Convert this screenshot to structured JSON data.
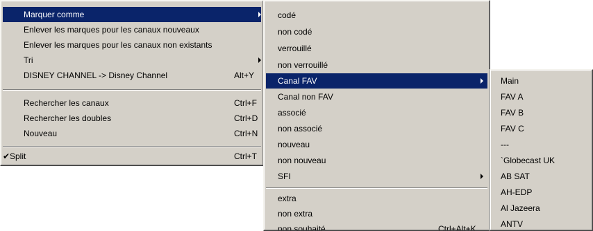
{
  "menu1": {
    "items": [
      {
        "label": "Marquer comme",
        "shortcut": "",
        "submenu": true,
        "selected": true
      },
      {
        "label": "Enlever les marques pour les canaux nouveaux",
        "shortcut": ""
      },
      {
        "label": "Enlever les marques pour les canaux non existants",
        "shortcut": ""
      },
      {
        "label": "Tri",
        "shortcut": "",
        "submenu": true
      },
      {
        "label": "DISNEY CHANNEL -> Disney Channel",
        "shortcut": "Alt+Y"
      },
      {
        "label": "Rechercher les canaux",
        "shortcut": "Ctrl+F"
      },
      {
        "label": "Rechercher les doubles",
        "shortcut": "Ctrl+D"
      },
      {
        "label": "Nouveau",
        "shortcut": "Ctrl+N"
      },
      {
        "label": "Split",
        "shortcut": "Ctrl+T",
        "checked": true
      }
    ]
  },
  "menu2": {
    "items": [
      {
        "label": "codé"
      },
      {
        "label": "non codé"
      },
      {
        "label": "verrouillé"
      },
      {
        "label": "non verrouillé"
      },
      {
        "label": "Canal FAV",
        "submenu": true,
        "selected": true
      },
      {
        "label": "Canal non FAV"
      },
      {
        "label": "associé"
      },
      {
        "label": "non associé"
      },
      {
        "label": "nouveau"
      },
      {
        "label": "non nouveau"
      },
      {
        "label": "SFI",
        "submenu": true
      },
      {
        "label": "extra"
      },
      {
        "label": "non extra"
      },
      {
        "label": "non souhaité",
        "shortcut": "Ctrl+Alt+K"
      }
    ]
  },
  "menu3": {
    "items": [
      {
        "label": "Main"
      },
      {
        "label": "FAV A"
      },
      {
        "label": "FAV B"
      },
      {
        "label": "FAV C"
      },
      {
        "label": "---"
      },
      {
        "label": "`Globecast UK"
      },
      {
        "label": "AB SAT"
      },
      {
        "label": "AH-EDP"
      },
      {
        "label": "Al Jazeera"
      },
      {
        "label": "ANTV"
      }
    ]
  },
  "icons": {
    "checkmark": "checkmark-icon",
    "submenu_arrow": "submenu-arrow-icon"
  }
}
